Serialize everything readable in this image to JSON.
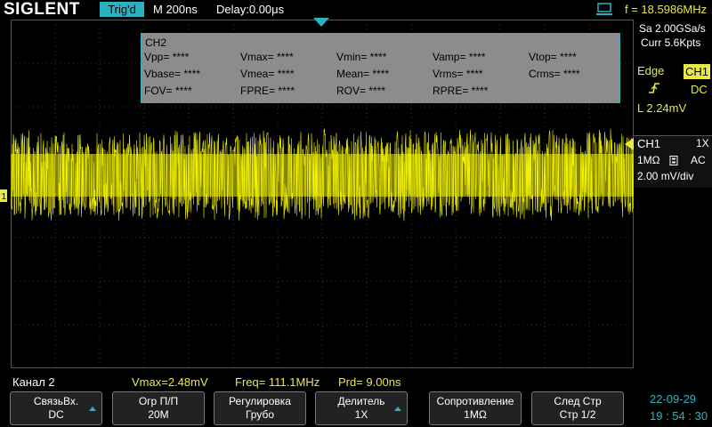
{
  "header": {
    "brand": "SIGLENT",
    "trigger_status": "Trig'd",
    "timebase": "M 200ns",
    "delay": "Delay:0.00μs",
    "frequency": "f = 18.5986MHz"
  },
  "acquisition": {
    "sample_rate": "Sa 2.00GSa/s",
    "memory": "Curr 5.6Kpts"
  },
  "trigger": {
    "type": "Edge",
    "source": "CH1",
    "coupling": "DC",
    "level": "L  2.24mV"
  },
  "channel": {
    "name": "CH1",
    "probe": "1X",
    "impedance": "1MΩ",
    "coupling": "AC",
    "scale": "2.00 mV/div"
  },
  "measurement_popup": {
    "title": "CH2",
    "rows": [
      [
        "Vpp= ****",
        "Vmax= ****",
        "Vmin= ****",
        "Vamp= ****",
        "Vtop= ****"
      ],
      [
        "Vbase= ****",
        "Vmea= ****",
        "Mean= ****",
        "Vrms= ****",
        "Crms= ****"
      ],
      [
        "FOV= ****",
        "FPRE= ****",
        "ROV= ****",
        "RPRE= ****",
        ""
      ]
    ]
  },
  "status": {
    "channel_label": "Канал 2",
    "vmax": "Vmax=2.48mV",
    "freq": "Freq= 111.1MHz",
    "prd": "Prd= 9.00ns"
  },
  "softkeys": [
    {
      "label": "СвязьВх.",
      "value": "DC"
    },
    {
      "label": "Огр П/П",
      "value": "20M"
    },
    {
      "label": "Регулировка",
      "value": "Грубо"
    },
    {
      "label": "Делитель",
      "value": "1X"
    },
    {
      "label": "Сопротивление",
      "value": "1MΩ"
    },
    {
      "label": "След  Стр",
      "value": "Стр 1/2"
    }
  ],
  "datetime": {
    "date": "22-09-29",
    "time": "19 : 54 : 30"
  },
  "colors": {
    "trace": "#f2f200",
    "accent": "#2bb2c2",
    "label_yellow": "#e8e84a"
  }
}
